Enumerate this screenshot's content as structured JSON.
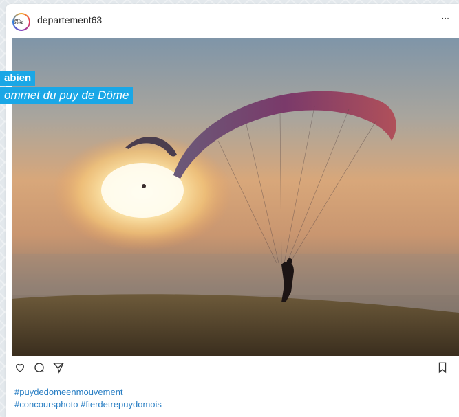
{
  "post": {
    "username": "departement63",
    "avatar_icon": "puy-de-dome-logo-icon",
    "avatar_text": "PUY-DÔME",
    "more_label": "···",
    "photo": {
      "caption_name": "abien",
      "caption_location": "ommet du puy de Dôme",
      "caption_color": "#1aa7e6"
    },
    "actions": {
      "like_icon": "heart-icon",
      "comment_icon": "comment-icon",
      "share_icon": "send-icon",
      "save_icon": "bookmark-icon"
    },
    "hashtags": [
      "#puydedomeenmouvement",
      "#concoursphoto #fierdetrepuydomois"
    ],
    "hashtag_color": "#2a7fc4"
  }
}
